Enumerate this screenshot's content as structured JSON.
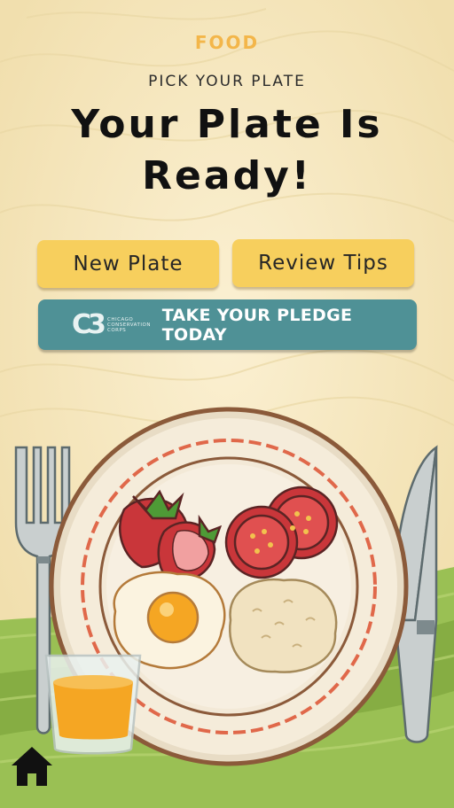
{
  "header": {
    "category": "FOOD",
    "subtitle": "PICK YOUR PLATE",
    "title": "Your Plate Is Ready!"
  },
  "buttons": {
    "new_plate": "New Plate",
    "review_tips": "Review Tips"
  },
  "pledge": {
    "logo_mark": "C3",
    "logo_text": "CHICAGO CONSERVATION CORPS",
    "label": "TAKE YOUR PLEDGE TODAY"
  },
  "nav": {
    "home_icon": "home-icon"
  },
  "colors": {
    "background": "#f6e6bd",
    "accent_yellow": "#f7cf5d",
    "pledge_teal": "#4f9196",
    "category_orange": "#f3b64a",
    "grass": "#8fb84a"
  }
}
